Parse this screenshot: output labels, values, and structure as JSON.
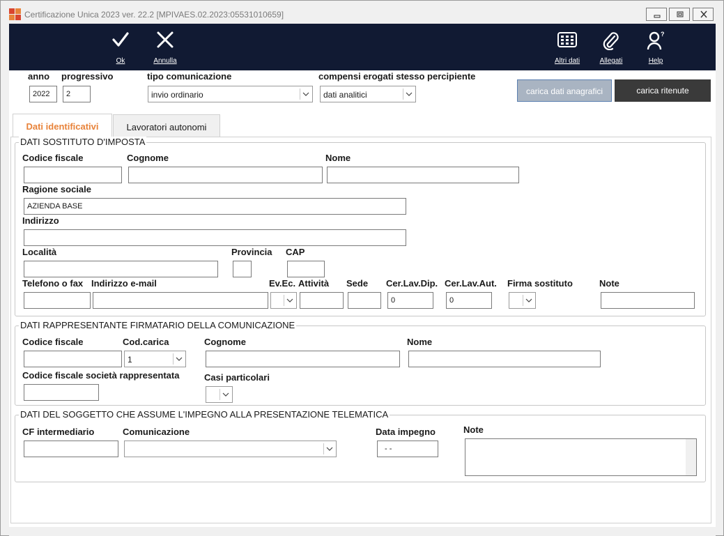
{
  "window": {
    "title": "Certificazione Unica 2023 ver. 22.2 [MPIVAES.02.2023:05531010659]"
  },
  "toolbar": {
    "ok_label": "Ok",
    "annulla_label": "Annulla",
    "altri_dati_label": "Altri dati",
    "allegati_label": "Allegati",
    "help_label": "Help"
  },
  "header": {
    "anno_label": "anno",
    "anno_value": "2022",
    "progressivo_label": "progressivo",
    "progressivo_value": "2",
    "tipo_label": "tipo comunicazione",
    "tipo_value": "invio ordinario",
    "compensi_label": "compensi erogati stesso percipiente",
    "compensi_value": "dati analitici",
    "carica_anagrafici_label": "carica dati anagrafici",
    "carica_ritenute_label": "carica ritenute"
  },
  "tabs": [
    {
      "label": "Dati identificativi",
      "active": true
    },
    {
      "label": "Lavoratori autonomi",
      "active": false
    }
  ],
  "sostituto": {
    "section_title": "DATI SOSTITUTO D'IMPOSTA",
    "codice_fiscale_label": "Codice fiscale",
    "codice_fiscale_value": "",
    "cognome_label": "Cognome",
    "cognome_value": "",
    "nome_label": "Nome",
    "nome_value": "",
    "ragione_sociale_label": "Ragione sociale",
    "ragione_sociale_value": "AZIENDA BASE",
    "indirizzo_label": "Indirizzo",
    "indirizzo_value": "",
    "localita_label": "Località",
    "localita_value": "",
    "provincia_label": "Provincia",
    "provincia_value": "",
    "cap_label": "CAP",
    "cap_value": "",
    "telefono_label": "Telefono o fax",
    "telefono_value": "",
    "email_label": "Indirizzo e-mail",
    "email_value": "",
    "evec_label": "Ev.Ec.",
    "evec_value": "",
    "attivita_label": "Attività",
    "attivita_value": "",
    "sede_label": "Sede",
    "sede_value": "",
    "cerlavdip_label": "Cer.Lav.Dip.",
    "cerlavdip_value": "0",
    "cerlavaut_label": "Cer.Lav.Aut.",
    "cerlavaut_value": "0",
    "firma_label": "Firma sostituto",
    "firma_value": "",
    "note_label": "Note",
    "note_value": ""
  },
  "rappresentante": {
    "section_title": "DATI RAPPRESENTANTE FIRMATARIO DELLA COMUNICAZIONE",
    "codice_fiscale_label": "Codice fiscale",
    "codice_fiscale_value": "",
    "cod_carica_label": "Cod.carica",
    "cod_carica_value": "1",
    "cognome_label": "Cognome",
    "cognome_value": "",
    "nome_label": "Nome",
    "nome_value": "",
    "cf_societa_label": "Codice fiscale società rappresentata",
    "cf_societa_value": "",
    "casi_label": "Casi particolari",
    "casi_value": ""
  },
  "telematica": {
    "section_title": "DATI DEL SOGGETTO CHE ASSUME L'IMPEGNO ALLA PRESENTAZIONE TELEMATICA",
    "cf_intermediario_label": "CF intermediario",
    "cf_intermediario_value": "",
    "comunicazione_label": "Comunicazione",
    "comunicazione_value": "",
    "data_impegno_label": "Data impegno",
    "data_impegno_value": "- -",
    "note_label": "Note",
    "note_value": ""
  },
  "colors": {
    "toolbar_bg": "#111a33",
    "active_tab_text": "#e8833a",
    "button_blue_bg": "#a9b4c2",
    "button_dark_bg": "#3a3a3a"
  },
  "icons": [
    "app-logo-icon",
    "minimize-icon",
    "restore-icon",
    "close-icon",
    "checkmark-icon",
    "x-icon",
    "grid-icon",
    "paperclip-icon",
    "help-person-icon",
    "chevron-down-icon"
  ]
}
